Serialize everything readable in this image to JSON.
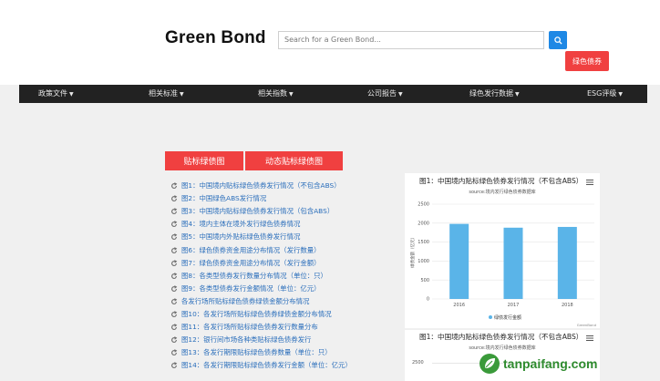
{
  "header": {
    "logo": "Green Bond",
    "search_placeholder": "Search for a Green Bond...",
    "red_button": "绿色债券"
  },
  "nav": [
    {
      "label": "政策文件"
    },
    {
      "label": "相关标准"
    },
    {
      "label": "相关指数"
    },
    {
      "label": "公司报告"
    },
    {
      "label": "绿色发行数据"
    },
    {
      "label": "ESG评级"
    }
  ],
  "tabs": {
    "t1": "贴标绿债图",
    "t2": "动态贴标绿债图"
  },
  "list": [
    "图1：中国境内贴标绿色债券发行情况（不包含ABS）",
    "图2：中国绿色ABS发行情况",
    "图3：中国境内贴标绿色债券发行情况（包含ABS）",
    "图4：境内主体在境外发行绿色债券情况",
    "图5：中国境内外贴标绿色债券发行情况",
    "图6：绿色债券资金用途分布情况（发行数量）",
    "图7：绿色债券资金用途分布情况（发行金额）",
    "图8：各类型债券发行数量分布情况（单位：只）",
    "图9：各类型债券发行金额情况（单位：亿元）",
    "各发行场所贴标绿色债券绿债金额分布情况",
    "图10：各发行场所贴标绿色债券绿债金额分布情况",
    "图11：各发行场所贴标绿色债券发行数量分布",
    "图12：银行间市场各种类贴标绿色债券发行",
    "图13：各发行期限贴标绿色债券数量（单位：只）",
    "图14：各发行期限贴标绿色债券发行金额（单位：亿元）"
  ],
  "chart_data": {
    "type": "bar",
    "title": "图1：中国境内贴标绿色债券发行情况（不包含ABS）",
    "subtitle": "source:境内发行绿色债券数据库",
    "ylabel": "绿债金额（亿元）",
    "categories": [
      "2016",
      "2017",
      "2018"
    ],
    "series": [
      {
        "name": "绿债发行金额",
        "values": [
          1980,
          1880,
          1900
        ]
      }
    ],
    "yticks": [
      0,
      500,
      1000,
      1500,
      2000,
      2500
    ],
    "ylim": [
      0,
      2500
    ],
    "credit": "GreenBond",
    "bar_color": "#5ab4e8"
  },
  "chart2": {
    "title": "图1：中国境内贴标绿色债券发行情况（不包含ABS）",
    "subtitle": "source:境内发行绿色债券数据库",
    "tick": "2500"
  },
  "watermark": {
    "text": "tanpaifang.com"
  }
}
